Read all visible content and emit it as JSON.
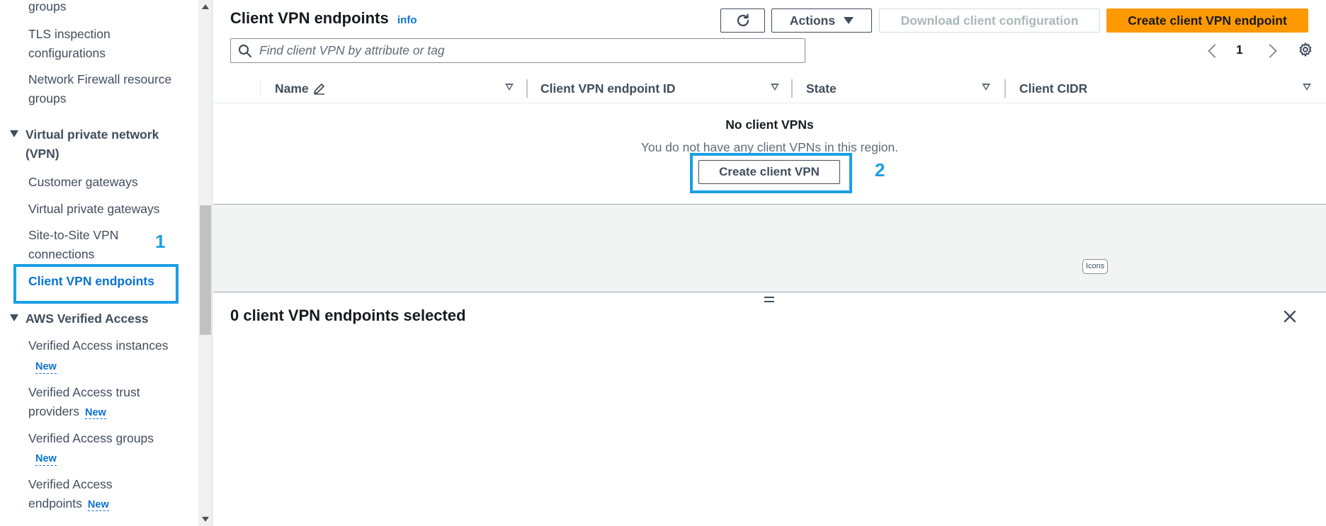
{
  "sidebar": {
    "items": [
      {
        "label": "groups"
      },
      {
        "label": "TLS inspection configurations"
      },
      {
        "label": "Network Firewall resource groups"
      }
    ],
    "vpn_section": {
      "label": "Virtual private network (VPN)",
      "items": [
        {
          "label": "Customer gateways"
        },
        {
          "label": "Virtual private gateways"
        },
        {
          "label": "Site-to-Site VPN connections"
        },
        {
          "label": "Client VPN endpoints"
        }
      ]
    },
    "verified_section": {
      "label": "AWS Verified Access",
      "items": [
        {
          "label": "Verified Access instances",
          "badge": "New"
        },
        {
          "label": "Verified Access trust providers",
          "badge": "New"
        },
        {
          "label": "Verified Access groups",
          "badge": "New"
        },
        {
          "label": "Verified Access endpoints",
          "badge": "New"
        }
      ]
    }
  },
  "header": {
    "title": "Client VPN endpoints",
    "info": "info",
    "actions_label": "Actions",
    "download_label": "Download client configuration",
    "create_label": "Create client VPN endpoint",
    "refresh_icon": "refresh-icon"
  },
  "search": {
    "placeholder": "Find client VPN by attribute or tag",
    "value": ""
  },
  "pagination": {
    "page": "1"
  },
  "table": {
    "columns": [
      {
        "label": "Name",
        "editable": true
      },
      {
        "label": "Client VPN endpoint ID"
      },
      {
        "label": "State"
      },
      {
        "label": "Client CIDR"
      }
    ],
    "empty_title": "No client VPNs",
    "empty_desc": "You do not have any client VPNs in this region.",
    "empty_button": "Create client VPN"
  },
  "tooltip": "Icons",
  "split_panel": {
    "title": "0 client VPN endpoints selected"
  },
  "annotations": {
    "one": "1",
    "two": "2",
    "color": "#1a9fe6"
  },
  "colors": {
    "primary": "#ff9900",
    "link": "#0972d3",
    "text": "#16191f"
  }
}
